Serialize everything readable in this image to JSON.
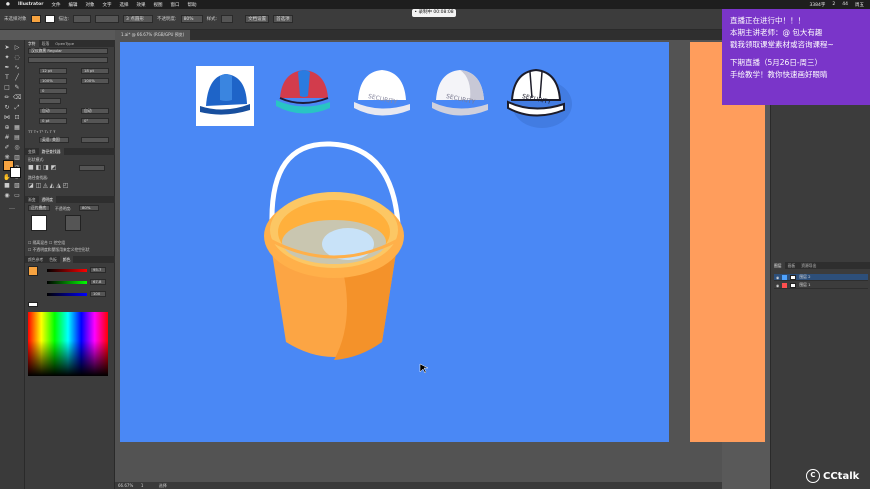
{
  "mac_menu": {
    "app": "Illustrator",
    "items": [
      "文件",
      "编辑",
      "对象",
      "文字",
      "选择",
      "效果",
      "视图",
      "窗口",
      "帮助"
    ],
    "right_items": [
      "3384字",
      "2",
      "44",
      "周五"
    ]
  },
  "recording_badge": "• 录制中 00:08:08",
  "options_bar": {
    "selection_label": "未选择对象",
    "stroke_label": "描边:",
    "brush_label": "3 点圆形",
    "opacity_label": "不透明度:",
    "opacity_value": "80%",
    "style_label": "样式:",
    "doc_setup": "文档设置",
    "prefs": "首选项",
    "fill_color": "#f7a340"
  },
  "document_tab": "1.ai* @ 66.67% (RGB/GPU 预览)",
  "character_panel": {
    "tabs": [
      "字符",
      "段落",
      "OpenType"
    ],
    "font": "汉仪旗黑 Regular",
    "size": "12 pt",
    "leading": "18 pt",
    "scale_h": "100%",
    "scale_v": "100%",
    "tracking": "0",
    "kerning": "自动",
    "baseline": "0 pt",
    "rotation": "0°",
    "language": "英语: 美国"
  },
  "pathfinder_panel": {
    "tabs": [
      "变换",
      "路径查找器"
    ],
    "shape_modes_label": "形状模式:",
    "pathfinders_label": "路径查找器:"
  },
  "transparency_panel": {
    "tabs": [
      "渐变",
      "透明度"
    ],
    "mode": "正片叠底",
    "opacity_label": "不透明度:",
    "opacity_value": "80%",
    "options": [
      "隔离混合",
      "挖空组",
      "不透明度和蒙版用来定义挖空形状"
    ]
  },
  "color_panel": {
    "tabs": [
      "颜色参考",
      "色板",
      "颜色"
    ],
    "values": [
      "95.7",
      "67.8",
      "100"
    ]
  },
  "layers_panel": {
    "tabs": [
      "图层",
      "画板",
      "资源导出"
    ],
    "layers": [
      {
        "name": "图层 2",
        "color": "#4fa3ff"
      },
      {
        "name": "图层 1",
        "color": "#ff4f4f"
      }
    ]
  },
  "live_banner": {
    "line1": "直播正在进行中！！！",
    "line2": "本期主讲老师：@ 包大有趣",
    "line3": "戳我领取课堂素材或咨询课程~",
    "line4": "下期直播（5月26日-周三）",
    "line5": "手绘教学！教你快速画好眼睛"
  },
  "artwork": {
    "helmet_text": "SECURITY",
    "bucket_color": "#fca544",
    "bucket_dark": "#f4922a",
    "helmet_blue": "#1e64c8"
  },
  "status_bar": {
    "zoom": "66.67%",
    "page": "1",
    "tool": "选择"
  },
  "watermark": "CCtalk"
}
